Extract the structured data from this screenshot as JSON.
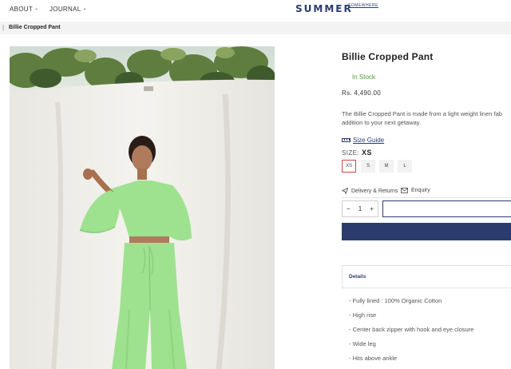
{
  "header": {
    "nav": [
      {
        "label": "ABOUT"
      },
      {
        "label": "JOURNAL"
      }
    ],
    "brand": "SUMMER",
    "brand_sub": "SOMEWHERE"
  },
  "breadcrumb": {
    "current": "Billie Cropped Pant"
  },
  "product": {
    "title": "Billie Cropped Pant",
    "stock": "In Stock",
    "price": "Rs. 4,490.00",
    "description_lines": [
      "The Billie Cropped Pant is made from a light weight linen fab",
      "addition to your next getaway."
    ],
    "size_guide_label": "Size Guide",
    "size_label": "SIZE:",
    "selected_size": "XS",
    "sizes": [
      "XS",
      "S",
      "M",
      "L"
    ],
    "delivery_label": "Delivery & Returns",
    "enquiry_label": "Enquiry",
    "quantity": "1",
    "qty_minus": "−",
    "qty_plus": "+",
    "details_tab": "Details",
    "details": [
      "- Fully lined : 100% Organic Cotton",
      "- High rise",
      "- Center back zipper with hook and eye closure",
      "- Wide leg",
      "- Hits above ankle"
    ]
  },
  "colors": {
    "brand_navy": "#2a3c6e",
    "in_stock_green": "#4c9a3a",
    "selected_border": "#d0463c",
    "outfit_green": "#9ee28f"
  },
  "icons": {
    "nav_chevron": "chevron-down-icon",
    "size_guide": "ruler-icon",
    "delivery": "paper-plane-icon",
    "enquiry": "mail-icon"
  }
}
